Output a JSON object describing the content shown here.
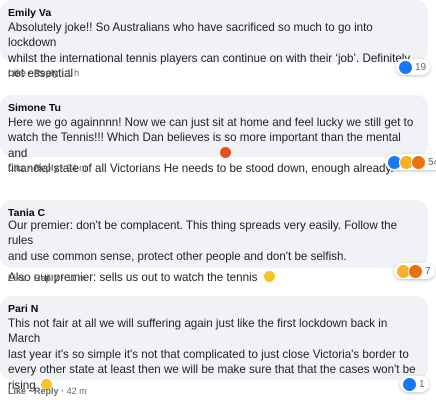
{
  "comments": [
    {
      "author": "Emily Va",
      "lines": [
        "Absolutely joke!! So Australians who have sacrificed so much to go into lockdown",
        "whilst the international tennis players can continue on with their ‘job’. Definitely",
        "not essential"
      ],
      "like": "Like",
      "reply": "Reply",
      "time": "1 h",
      "reactions": [
        "like"
      ],
      "reaction_count": "19"
    },
    {
      "author": "Simone Tu",
      "lines": [
        "Here we go againnnn! Now we can just sit at home and feel lucky we still get to",
        "watch the Tennis!!! Which Dan believes is so more important than the mental and",
        "financial state of all Victorians He needs to be stood down, enough already."
      ],
      "like": "Like",
      "reply": "Reply",
      "time": "24 m",
      "reactions": [
        "like",
        "haha",
        "angry"
      ],
      "reaction_count": "54"
    },
    {
      "author": "Tania C",
      "lines": [
        "Our premier: don't be complacent. This thing spreads very easily. Follow the rules",
        "and use common sense, protect other people and don't be selfish.",
        "Also our premier: sells us out to watch the tennis"
      ],
      "like": "Like",
      "reply": "Reply",
      "time": "11 m",
      "reactions": [
        "haha",
        "angry"
      ],
      "reaction_count": "7"
    },
    {
      "author": "Pari N",
      "lines": [
        "This not fair at all we will suffering again just like the first lockdown back in March",
        "last year it's so simple it's not that complicated to just close Victoria's border to",
        "every other state at least then we will be make sure that that the cases won't be",
        "rising"
      ],
      "like": "Like",
      "reply": "Reply",
      "time": "42 m",
      "reactions": [
        "like"
      ],
      "reaction_count": "1"
    }
  ],
  "separator": "·",
  "colors": {
    "like": "#1877f2",
    "haha": "#f7b125",
    "angry": "#e9710f"
  }
}
